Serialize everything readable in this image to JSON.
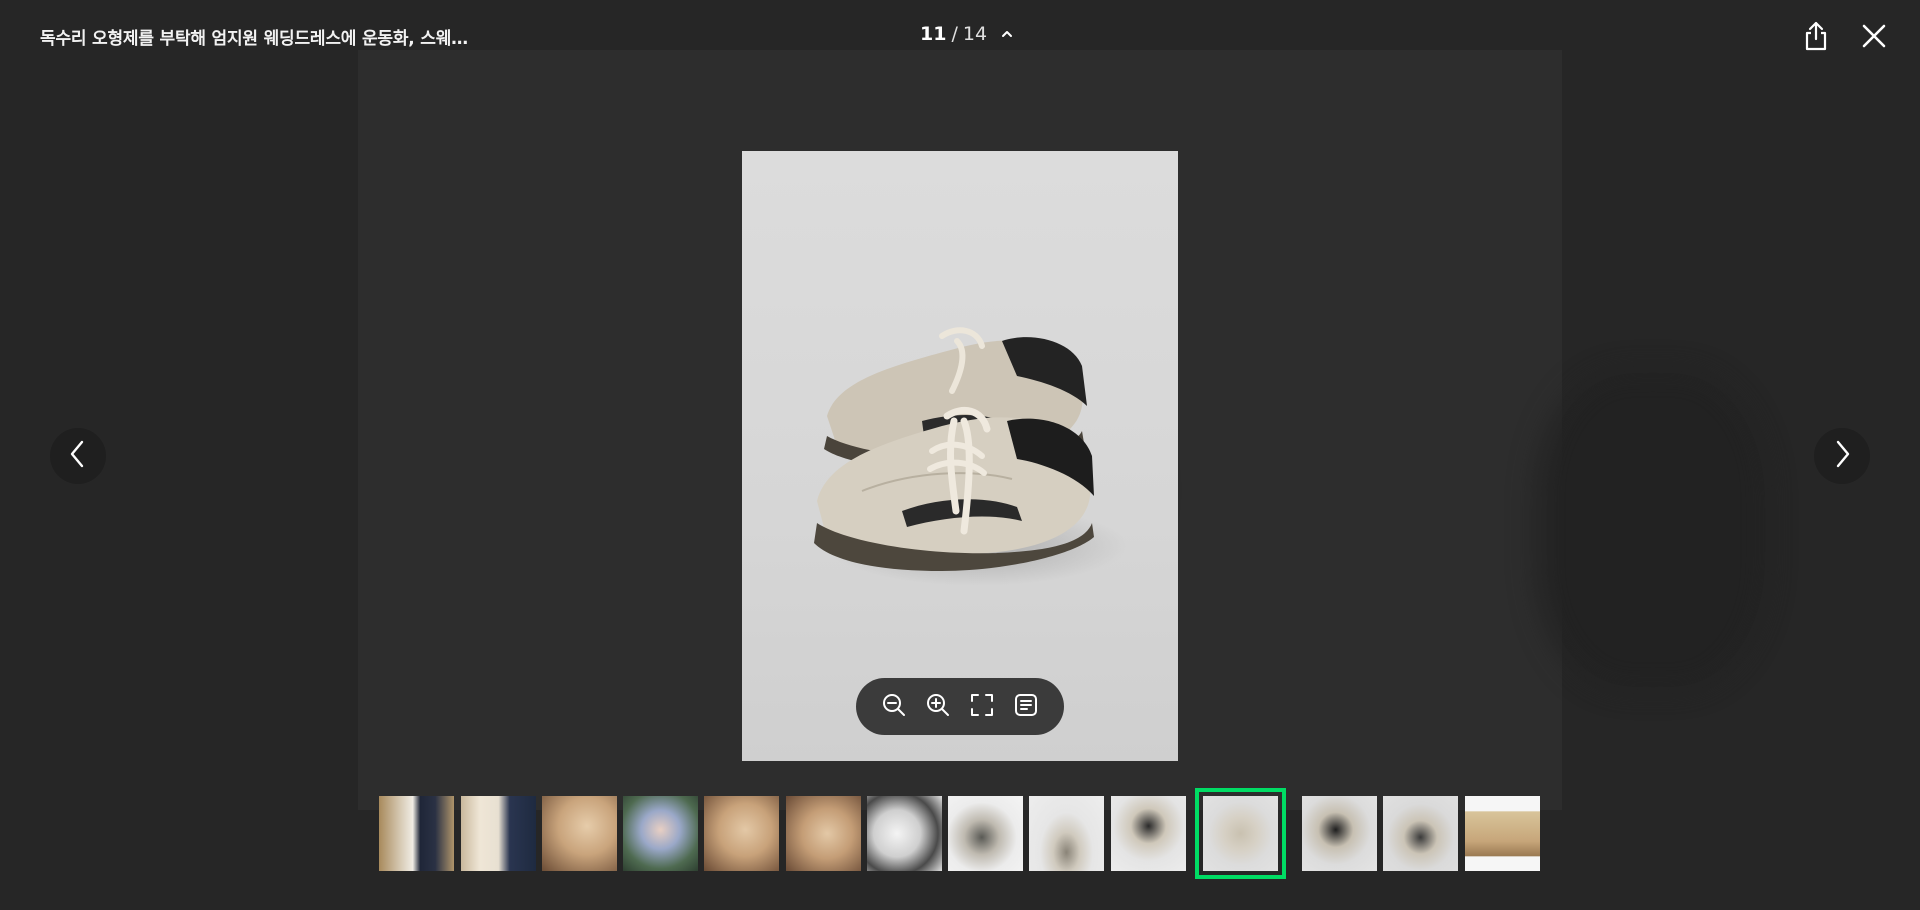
{
  "header": {
    "title": "독수리 오형제를 부탁해 엄지원 웨딩드레스에 운동화, 스웨…",
    "counter": {
      "current": "11",
      "separator": "/",
      "total": "14"
    }
  },
  "icons": {
    "share": "share-icon",
    "close": "close-icon",
    "prev": "chevron-left-icon",
    "next": "chevron-right-icon",
    "toggle": "chevron-up-icon",
    "zoom_out": "zoom-out-icon",
    "zoom_in": "zoom-in-icon",
    "fullscreen": "fullscreen-icon",
    "text": "text-view-icon"
  },
  "colors": {
    "active_outline": "#00dc64",
    "background": "#262626"
  },
  "thumbnails": [
    {
      "index": 1,
      "desc": "wedding couple"
    },
    {
      "index": 2,
      "desc": "couple with logo wall"
    },
    {
      "index": 3,
      "desc": "beige shoe close-up"
    },
    {
      "index": 4,
      "desc": "woman with flowers"
    },
    {
      "index": 5,
      "desc": "beige shoe close-up"
    },
    {
      "index": 6,
      "desc": "beige shoe close-up"
    },
    {
      "index": 7,
      "desc": "sneaker detail"
    },
    {
      "index": 8,
      "desc": "pair of sneakers"
    },
    {
      "index": 9,
      "desc": "sneaker side view"
    },
    {
      "index": 10,
      "desc": "sneakers top view"
    },
    {
      "index": 11,
      "desc": "sneakers pair",
      "active": true
    },
    {
      "index": 12,
      "desc": "sneakers pair dark"
    },
    {
      "index": 13,
      "desc": "single sneaker"
    },
    {
      "index": 14,
      "desc": "person with logo"
    }
  ]
}
